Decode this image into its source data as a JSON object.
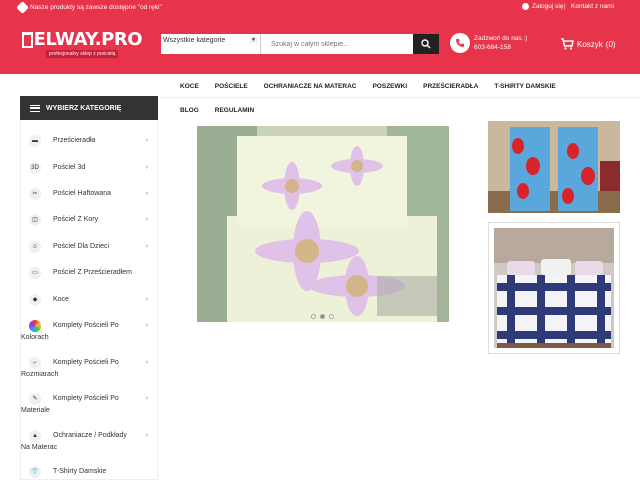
{
  "topbar": {
    "promo": "Nasze produkty są zawsze dostępne \"od ręki\"",
    "login": "Zaloguj się",
    "separator": "|",
    "register": "Kontakt z nami"
  },
  "logo": {
    "brand": "ELWAY.PRO",
    "tagline": "profesjonalny sklep z pościelą"
  },
  "search": {
    "category": "Wszystkie kategorie",
    "placeholder": "Szukaj w całym sklepie..."
  },
  "contact": {
    "line1": "Zadzwoń do nas :)",
    "line2": "603-684-158"
  },
  "cart": {
    "label": "Koszyk",
    "count": "(0)"
  },
  "nav": {
    "row1": [
      "KOCE",
      "POŚCIELE",
      "OCHRANIACZE NA MATERAC",
      "POSZEWKI",
      "PRZEŚCIERADŁA",
      "T-SHIRTY DAMSKIE"
    ],
    "row2": [
      "BLOG",
      "REGULAMIN"
    ]
  },
  "sidebar": {
    "title": "WYBIERZ KATEGORIĘ",
    "items": [
      {
        "label": "Prześcieradła",
        "icon": "bed-sheet-icon"
      },
      {
        "label": "Pościel 3d",
        "icon": "3d-icon"
      },
      {
        "label": "Pościel Haftowana",
        "icon": "embroidery-icon"
      },
      {
        "label": "Pościel Z Kory",
        "icon": "bark-icon"
      },
      {
        "label": "Pościel Dla Dzieci",
        "icon": "child-icon"
      },
      {
        "label": "Pościel Z Prześcieradłem",
        "icon": "bedding-set-icon"
      },
      {
        "label": "Koce",
        "icon": "blanket-icon"
      },
      {
        "label": "Komplety Pościeli Po",
        "label2": "Kolorach",
        "icon": "color-palette-icon"
      },
      {
        "label": "Komplety Pościeli Po",
        "label2": "Rozmiarach",
        "icon": "size-icon"
      },
      {
        "label": "Komplety Pościeli Po",
        "label2": "Materiale",
        "icon": "fabric-icon"
      },
      {
        "label": "Ochraniacze / Podkłady",
        "label2": "Na Materac",
        "icon": "mattress-icon"
      },
      {
        "label": "T-Shirty Damskie",
        "icon": "tshirt-icon"
      }
    ]
  },
  "slider": {
    "slides": 3,
    "active": 2
  },
  "colors": {
    "brand": "#e8344a",
    "dark": "#222222"
  }
}
